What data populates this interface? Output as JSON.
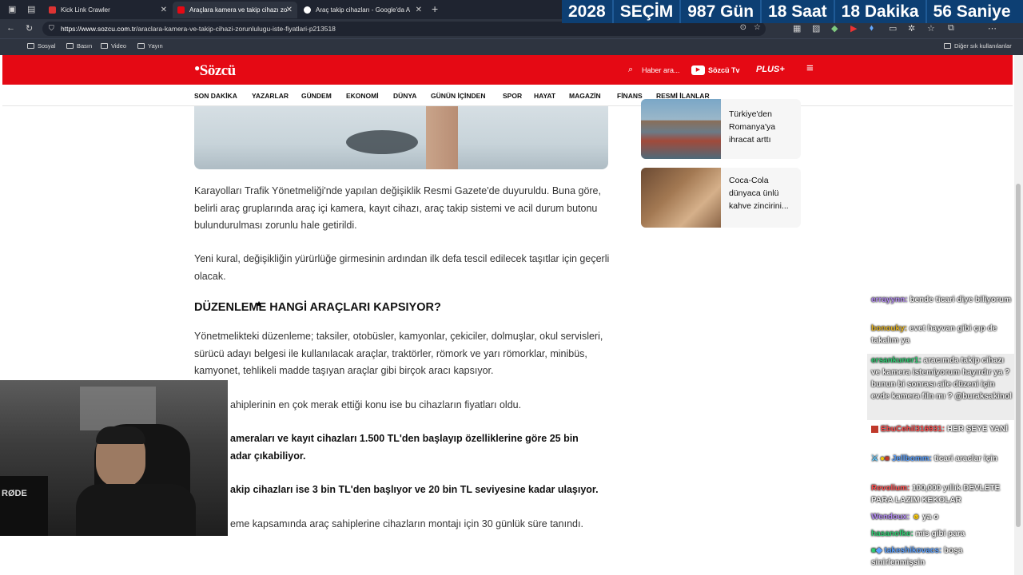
{
  "browser": {
    "tabs": [
      {
        "title": "Kick Link Crawler",
        "active": false
      },
      {
        "title": "Araçlara kamera ve takip cihazı zo",
        "active": true
      },
      {
        "title": "Araç takip cihazları - Google'da A",
        "active": false
      }
    ],
    "new_tab_symbol": "+",
    "url_host": "https://www.sozcu.com.tr",
    "url_path": "/araclara-kamera-ve-takip-cihazi-zorunlulugu-iste-fiyatlari-p213518",
    "bookmarks": [
      "Sosyal",
      "Basın",
      "Video",
      "Yayın"
    ],
    "other_bookmarks": "Diğer sık kullanılanlar"
  },
  "countdown": [
    "2028",
    "SEÇİM",
    "987 Gün",
    "18 Saat",
    "18 Dakika",
    "56 Saniye"
  ],
  "site": {
    "logo": "Sözcü",
    "search_placeholder": "Haber ara...",
    "tv_label": "Sözcü Tv",
    "plus_label": "PLUS+",
    "nav": [
      "SON DAKİKA",
      "YAZARLAR",
      "GÜNDEM",
      "EKONOMİ",
      "DÜNYA",
      "GÜNÜN İÇİNDEN",
      "SPOR",
      "HAYAT",
      "MAGAZİN",
      "FİNANS",
      "RESMİ İLANLAR"
    ]
  },
  "article": {
    "p1": "Karayolları Trafik Yönetmeliği'nde yapılan değişiklik Resmi Gazete'de duyuruldu. Buna göre, belirli araç gruplarında araç içi kamera, kayıt cihazı, araç takip sistemi ve acil durum butonu bulundurulması zorunlu hale getirildi.",
    "p2": "Yeni kural, değişikliğin yürürlüğe girmesinin ardından ilk defa tescil edilecek taşıtlar için geçerli olacak.",
    "heading": "DÜZENLEME HANGİ ARAÇLARI KAPSIYOR?",
    "p3": "Yönetmelikteki düzenleme; taksiler, otobüsler, kamyonlar, çekiciler, dolmuşlar, okul servisleri, sürücü adayı belgesi ile kullanılacak araçlar, traktörler, römork ve yarı römorklar, minibüs, kamyonet, tehlikeli madde taşıyan araçlar gibi birçok aracı kapsıyor.",
    "p4": "ahiplerinin en çok merak ettiği konu ise bu cihazların fiyatları oldu.",
    "p5a": "ameraları ve kayıt cihazları 1.500 TL'den başlayıp özelliklerine göre 25 bin",
    "p5b": "adar çıkabiliyor.",
    "p6": "akip cihazları ise 3 bin TL'den başlıyor ve 20 bin TL seviyesine kadar ulaşıyor.",
    "p7": "eme kapsamında araç sahiplerine cihazların montajı için 30 günlük süre tanındı."
  },
  "sidebar": [
    {
      "title": "Türkiye'den Romanya'ya ihracat arttı"
    },
    {
      "title": "Coca-Cola dünyaca ünlü kahve zincirini..."
    }
  ],
  "chat": [
    {
      "user": "errayynn:",
      "msg": "bende ticari diye biliyorum",
      "color": "#b48cf2"
    },
    {
      "user": "bonouky:",
      "msg": "evet hayvan gibi çıp de takalım ya",
      "color": "#e6b422"
    },
    {
      "user": "ersankuner1:",
      "msg": "aracımda takip cihazı ve kamera istemiyorum hayırdır ya ? bunun bi sonrası aile düzeni için evde kamera filn mı ? @buraksakinol",
      "color": "#2ecc71"
    },
    {
      "user": "EbuCehil316931:",
      "msg": "HER ŞEYE YANİ",
      "color": "#ff4d4d"
    },
    {
      "user": "Jellbomm:",
      "msg": "ticari araclar için",
      "color": "#5aa0ff"
    },
    {
      "user": "Revolium:",
      "msg": "100,000 yıllık DEVLETE PARA LAZIM KEKOLAR",
      "color": "#ff5050"
    },
    {
      "user": "Wendoux:",
      "msg": "ya o",
      "color": "#b48cf2"
    },
    {
      "user": "hasanofke:",
      "msg": "mis gibi para",
      "color": "#2ecc71"
    },
    {
      "user": "takeshikovacs:",
      "msg": "boşa sinirlenmişsin",
      "color": "#5aa0ff"
    }
  ],
  "colors": {
    "brand_red": "#e50914",
    "countdown_bg": "#0d3f73",
    "browser_dark": "#2e3440"
  },
  "webcam_mic_label": "RØDE"
}
